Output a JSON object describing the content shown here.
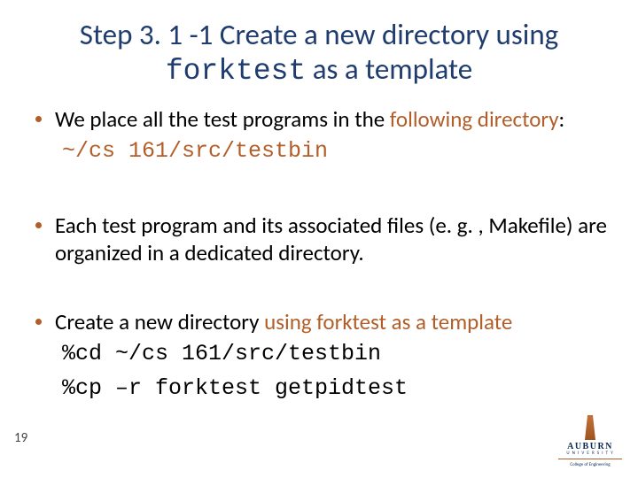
{
  "title": {
    "pre": "Step 3. 1 -1 Create a new directory using ",
    "code": "forktest",
    "post": " as a template"
  },
  "bullets": {
    "b1": {
      "text_pre": "We place all the test programs in the ",
      "text_accent": "following directory",
      "text_post": ":",
      "path": "~/cs 161/src/testbin"
    },
    "b2": {
      "text": "Each test program and its associated files (e. g. , Makefile) are organized in a dedicated directory."
    },
    "b3": {
      "text_pre": "Create a new directory ",
      "text_accent": "using forktest as a template",
      "cmd1": "%cd ~/cs 161/src/testbin",
      "cmd2": "%cp –r forktest getpidtest"
    }
  },
  "page_number": "19",
  "logo": {
    "name": "AUBURN",
    "uni": "U N I V E R S I T Y",
    "coe": "College of Engineering"
  }
}
